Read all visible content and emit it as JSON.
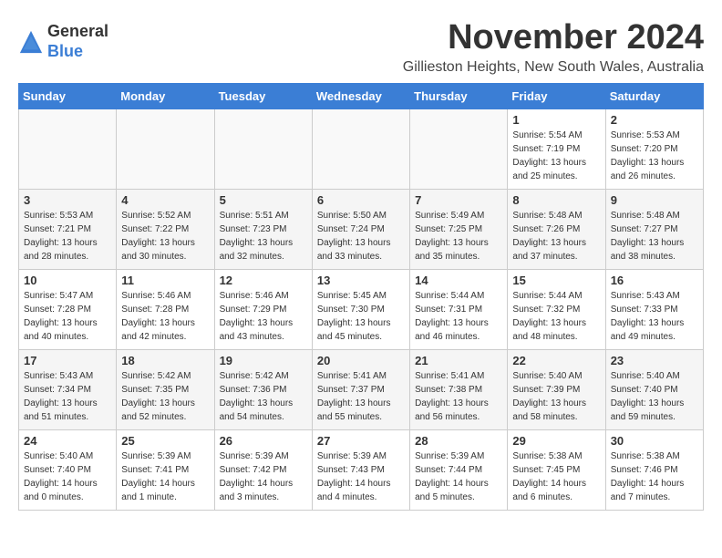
{
  "logo": {
    "general": "General",
    "blue": "Blue"
  },
  "title": "November 2024",
  "location": "Gillieston Heights, New South Wales, Australia",
  "headers": [
    "Sunday",
    "Monday",
    "Tuesday",
    "Wednesday",
    "Thursday",
    "Friday",
    "Saturday"
  ],
  "weeks": [
    [
      {
        "day": "",
        "info": ""
      },
      {
        "day": "",
        "info": ""
      },
      {
        "day": "",
        "info": ""
      },
      {
        "day": "",
        "info": ""
      },
      {
        "day": "",
        "info": ""
      },
      {
        "day": "1",
        "info": "Sunrise: 5:54 AM\nSunset: 7:19 PM\nDaylight: 13 hours\nand 25 minutes."
      },
      {
        "day": "2",
        "info": "Sunrise: 5:53 AM\nSunset: 7:20 PM\nDaylight: 13 hours\nand 26 minutes."
      }
    ],
    [
      {
        "day": "3",
        "info": "Sunrise: 5:53 AM\nSunset: 7:21 PM\nDaylight: 13 hours\nand 28 minutes."
      },
      {
        "day": "4",
        "info": "Sunrise: 5:52 AM\nSunset: 7:22 PM\nDaylight: 13 hours\nand 30 minutes."
      },
      {
        "day": "5",
        "info": "Sunrise: 5:51 AM\nSunset: 7:23 PM\nDaylight: 13 hours\nand 32 minutes."
      },
      {
        "day": "6",
        "info": "Sunrise: 5:50 AM\nSunset: 7:24 PM\nDaylight: 13 hours\nand 33 minutes."
      },
      {
        "day": "7",
        "info": "Sunrise: 5:49 AM\nSunset: 7:25 PM\nDaylight: 13 hours\nand 35 minutes."
      },
      {
        "day": "8",
        "info": "Sunrise: 5:48 AM\nSunset: 7:26 PM\nDaylight: 13 hours\nand 37 minutes."
      },
      {
        "day": "9",
        "info": "Sunrise: 5:48 AM\nSunset: 7:27 PM\nDaylight: 13 hours\nand 38 minutes."
      }
    ],
    [
      {
        "day": "10",
        "info": "Sunrise: 5:47 AM\nSunset: 7:28 PM\nDaylight: 13 hours\nand 40 minutes."
      },
      {
        "day": "11",
        "info": "Sunrise: 5:46 AM\nSunset: 7:28 PM\nDaylight: 13 hours\nand 42 minutes."
      },
      {
        "day": "12",
        "info": "Sunrise: 5:46 AM\nSunset: 7:29 PM\nDaylight: 13 hours\nand 43 minutes."
      },
      {
        "day": "13",
        "info": "Sunrise: 5:45 AM\nSunset: 7:30 PM\nDaylight: 13 hours\nand 45 minutes."
      },
      {
        "day": "14",
        "info": "Sunrise: 5:44 AM\nSunset: 7:31 PM\nDaylight: 13 hours\nand 46 minutes."
      },
      {
        "day": "15",
        "info": "Sunrise: 5:44 AM\nSunset: 7:32 PM\nDaylight: 13 hours\nand 48 minutes."
      },
      {
        "day": "16",
        "info": "Sunrise: 5:43 AM\nSunset: 7:33 PM\nDaylight: 13 hours\nand 49 minutes."
      }
    ],
    [
      {
        "day": "17",
        "info": "Sunrise: 5:43 AM\nSunset: 7:34 PM\nDaylight: 13 hours\nand 51 minutes."
      },
      {
        "day": "18",
        "info": "Sunrise: 5:42 AM\nSunset: 7:35 PM\nDaylight: 13 hours\nand 52 minutes."
      },
      {
        "day": "19",
        "info": "Sunrise: 5:42 AM\nSunset: 7:36 PM\nDaylight: 13 hours\nand 54 minutes."
      },
      {
        "day": "20",
        "info": "Sunrise: 5:41 AM\nSunset: 7:37 PM\nDaylight: 13 hours\nand 55 minutes."
      },
      {
        "day": "21",
        "info": "Sunrise: 5:41 AM\nSunset: 7:38 PM\nDaylight: 13 hours\nand 56 minutes."
      },
      {
        "day": "22",
        "info": "Sunrise: 5:40 AM\nSunset: 7:39 PM\nDaylight: 13 hours\nand 58 minutes."
      },
      {
        "day": "23",
        "info": "Sunrise: 5:40 AM\nSunset: 7:40 PM\nDaylight: 13 hours\nand 59 minutes."
      }
    ],
    [
      {
        "day": "24",
        "info": "Sunrise: 5:40 AM\nSunset: 7:40 PM\nDaylight: 14 hours\nand 0 minutes."
      },
      {
        "day": "25",
        "info": "Sunrise: 5:39 AM\nSunset: 7:41 PM\nDaylight: 14 hours\nand 1 minute."
      },
      {
        "day": "26",
        "info": "Sunrise: 5:39 AM\nSunset: 7:42 PM\nDaylight: 14 hours\nand 3 minutes."
      },
      {
        "day": "27",
        "info": "Sunrise: 5:39 AM\nSunset: 7:43 PM\nDaylight: 14 hours\nand 4 minutes."
      },
      {
        "day": "28",
        "info": "Sunrise: 5:39 AM\nSunset: 7:44 PM\nDaylight: 14 hours\nand 5 minutes."
      },
      {
        "day": "29",
        "info": "Sunrise: 5:38 AM\nSunset: 7:45 PM\nDaylight: 14 hours\nand 6 minutes."
      },
      {
        "day": "30",
        "info": "Sunrise: 5:38 AM\nSunset: 7:46 PM\nDaylight: 14 hours\nand 7 minutes."
      }
    ]
  ]
}
